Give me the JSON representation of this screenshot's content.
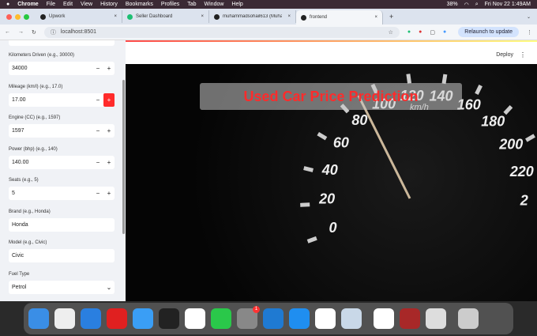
{
  "menubar": {
    "apple": "",
    "app": "Chrome",
    "items": [
      "File",
      "Edit",
      "View",
      "History",
      "Bookmarks",
      "Profiles",
      "Tab",
      "Window",
      "Help"
    ],
    "battery": "38%",
    "datetime": "Fri Nov 22  1:49AM"
  },
  "tabs": [
    {
      "label": "Upwork"
    },
    {
      "label": "Seller Dashboard"
    },
    {
      "label": "muhammadsohail613 (Muha"
    },
    {
      "label": "frontend"
    }
  ],
  "address": {
    "url": "localhost:8501",
    "relaunch": "Relaunch to update"
  },
  "sidebar": {
    "fields": [
      {
        "label": "Kilometers Driven (e.g., 30000)",
        "value": "34000",
        "type": "number"
      },
      {
        "label": "Mileage (km/l) (e.g., 17.0)",
        "value": "17.00",
        "type": "number",
        "hot": true
      },
      {
        "label": "Engine (CC) (e.g., 1597)",
        "value": "1597",
        "type": "number"
      },
      {
        "label": "Power (bhp) (e.g., 140)",
        "value": "140.00",
        "type": "number"
      },
      {
        "label": "Seats (e.g., 5)",
        "value": "5",
        "type": "number"
      },
      {
        "label": "Brand (e.g., Honda)",
        "value": "Honda",
        "type": "text"
      },
      {
        "label": "Model (e.g., Civic)",
        "value": "Civic",
        "type": "text"
      },
      {
        "label": "Fuel Type",
        "value": "Petrol",
        "type": "select"
      }
    ]
  },
  "main": {
    "deploy": "Deploy",
    "menu": "⋮",
    "title": "Used Car Price Prediction",
    "gauge": {
      "labels": [
        "0",
        "20",
        "40",
        "60",
        "80",
        "100",
        "120",
        "140",
        "160",
        "180",
        "200",
        "220",
        "2"
      ],
      "unit": "km/h"
    }
  },
  "dock": {
    "apps": [
      "finder",
      "launchpad",
      "safari",
      "opera",
      "mail",
      "terminal",
      "photos",
      "facetime",
      "settings",
      "vscode",
      "app-store",
      "chatgpt",
      "preview",
      "chrome",
      "dictionary",
      "screenshot",
      "trash"
    ],
    "settings_badge": "1"
  }
}
